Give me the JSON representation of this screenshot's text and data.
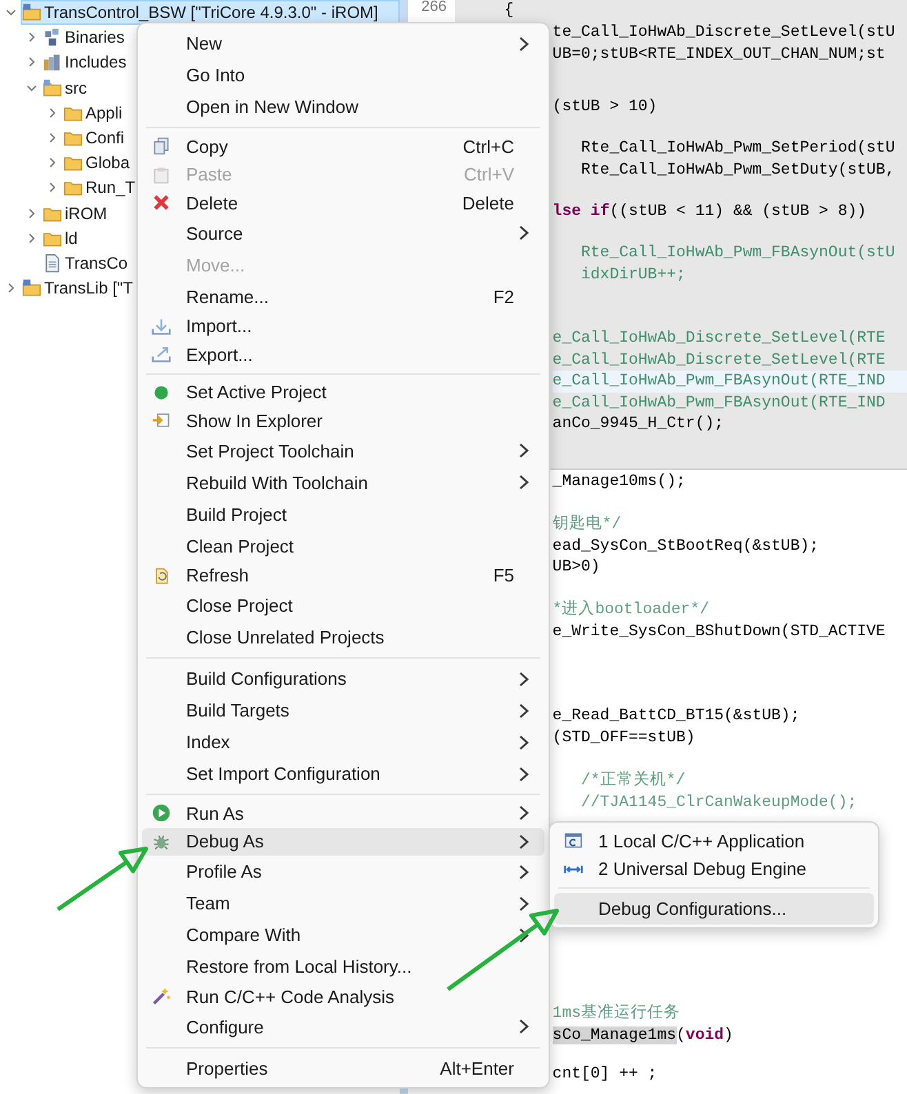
{
  "explorer": {
    "items": [
      {
        "label": "TransControl_BSW [\"TriCore 4.9.3.0\" - iROM]",
        "kind": "project",
        "expanded": true,
        "selected": true,
        "children": [
          {
            "label": "Binaries",
            "kind": "binaries",
            "expanded": false,
            "selected": false
          },
          {
            "label": "Includes",
            "kind": "includes",
            "expanded": false,
            "selected": false
          },
          {
            "label": "src",
            "kind": "source-folder",
            "expanded": true,
            "selected": false,
            "children": [
              {
                "label": "Appli",
                "kind": "folder",
                "expanded": false,
                "selected": false
              },
              {
                "label": "Confi",
                "kind": "folder",
                "expanded": false,
                "selected": false
              },
              {
                "label": "Globa",
                "kind": "folder",
                "expanded": false,
                "selected": false
              },
              {
                "label": "Run_T",
                "kind": "folder",
                "expanded": false,
                "selected": false
              }
            ]
          },
          {
            "label": "iROM",
            "kind": "folder",
            "expanded": false,
            "selected": false
          },
          {
            "label": "ld",
            "kind": "folder",
            "expanded": false,
            "selected": false
          },
          {
            "label": "TransCo",
            "kind": "file",
            "selected": false
          }
        ]
      },
      {
        "label": "TransLib [\"T",
        "kind": "project",
        "expanded": false,
        "selected": false
      }
    ]
  },
  "editor": {
    "line_numbers": [
      "266"
    ],
    "popup_blocks": [
      [
        {
          "current": false,
          "segments": [
            {
              "kind": "plain",
              "text": "{"
            }
          ]
        }
      ],
      [
        {
          "current": false,
          "segments": [
            {
              "kind": "plain",
              "text": "te_Call_IoHwAb_Discrete_SetLevel(stU"
            }
          ]
        }
      ],
      [
        {
          "current": false,
          "segments": [
            {
              "kind": "plain",
              "text": "UB=0;stUB<RTE_INDEX_OUT_CHAN_NUM;st"
            }
          ]
        }
      ],
      [
        {
          "current": false,
          "segments": [
            {
              "kind": "plain",
              "text": "(stUB > 10)"
            }
          ]
        }
      ],
      [
        {
          "current": false,
          "segments": [
            {
              "kind": "plain",
              "text": "   Rte_Call_IoHwAb_Pwm_SetPeriod(stU"
            }
          ]
        },
        {
          "current": false,
          "segments": [
            {
              "kind": "plain",
              "text": "   Rte_Call_IoHwAb_Pwm_SetDuty(stUB,"
            }
          ]
        }
      ],
      [
        {
          "current": false,
          "segments": [
            {
              "kind": "keyword",
              "text": "lse"
            },
            {
              "kind": "keyword",
              "text": " if"
            },
            {
              "kind": "plain",
              "text": "((stUB < 11) && (stUB > 8))"
            }
          ]
        }
      ],
      [
        {
          "current": false,
          "segments": [
            {
              "kind": "dim",
              "text": "   Rte_Call_IoHwAb_Pwm_FBAsynOut(stU"
            }
          ]
        },
        {
          "current": false,
          "segments": [
            {
              "kind": "dim",
              "text": "   idxDirUB++;"
            }
          ]
        }
      ],
      [
        {
          "current": false,
          "segments": [
            {
              "kind": "dim",
              "text": "e_Call_IoHwAb_Discrete_SetLevel(RTE"
            }
          ]
        },
        {
          "current": false,
          "segments": [
            {
              "kind": "dim",
              "text": "e_Call_IoHwAb_Discrete_SetLevel(RTE"
            }
          ]
        },
        {
          "current": true,
          "segments": [
            {
              "kind": "dim",
              "text": "e_Call_IoHwAb_Pwm_FBAsynOut(RTE_IND"
            }
          ]
        },
        {
          "current": false,
          "segments": [
            {
              "kind": "dim",
              "text": "e_Call_IoHwAb_Pwm_FBAsynOut(RTE_IND"
            }
          ]
        },
        {
          "current": false,
          "segments": [
            {
              "kind": "plain",
              "text": "anCo_9945_H_Ctr();"
            }
          ]
        }
      ]
    ],
    "blocks": [
      [
        {
          "current": false,
          "segments": [
            {
              "kind": "plain",
              "text": "_Manage10ms();"
            }
          ]
        }
      ],
      [
        {
          "current": false,
          "segments": [
            {
              "kind": "comment",
              "text": "钥匙电*/"
            }
          ]
        },
        {
          "current": false,
          "segments": [
            {
              "kind": "plain",
              "text": "ead_SysCon_StBootReq(&stUB);"
            }
          ]
        },
        {
          "current": false,
          "segments": [
            {
              "kind": "plain",
              "text": "UB>0)"
            }
          ]
        }
      ],
      [
        {
          "current": false,
          "segments": [
            {
              "kind": "comment",
              "text": "*进入bootloader*/"
            }
          ]
        },
        {
          "current": false,
          "segments": [
            {
              "kind": "plain",
              "text": "e_Write_SysCon_BShutDown(STD_ACTIVE"
            }
          ]
        }
      ],
      [
        {
          "current": false,
          "segments": [
            {
              "kind": "plain",
              "text": "e_Read_BattCD_BT15(&stUB);"
            }
          ]
        },
        {
          "current": false,
          "segments": [
            {
              "kind": "plain",
              "text": "(STD_OFF==stUB)"
            }
          ]
        }
      ],
      [
        {
          "current": false,
          "segments": [
            {
              "kind": "comment",
              "text": "   /*正常关机*/"
            }
          ]
        },
        {
          "current": false,
          "segments": [
            {
              "kind": "comment",
              "text": "   //TJA1145_ClrCanWakeupMode();"
            }
          ]
        }
      ],
      [
        {
          "current": false,
          "segments": [
            {
              "kind": "comment",
              "text": "1ms基准运行任务"
            }
          ]
        },
        {
          "current": false,
          "segments": [
            {
              "kind": "occurrence",
              "text": "sCo_Manage1ms"
            },
            {
              "kind": "plain",
              "text": "("
            },
            {
              "kind": "keyword",
              "text": "void"
            },
            {
              "kind": "plain",
              "text": ")"
            }
          ]
        }
      ],
      [
        {
          "current": false,
          "segments": [
            {
              "kind": "plain",
              "text": "cnt[0] ++ ;"
            }
          ]
        }
      ]
    ]
  },
  "context_menu": {
    "groups": [
      {
        "items": [
          {
            "label": "New",
            "submenu": true,
            "disabled": false,
            "selected": false
          },
          {
            "label": "Go Into",
            "submenu": false,
            "disabled": false,
            "selected": false
          },
          {
            "label": "Open in New Window",
            "submenu": false,
            "disabled": false,
            "selected": false
          }
        ]
      },
      {
        "items": [
          {
            "label": "Copy",
            "shortcut": "Ctrl+C",
            "kind": "copy",
            "submenu": false,
            "disabled": false,
            "selected": false
          },
          {
            "label": "Paste",
            "shortcut": "Ctrl+V",
            "kind": "paste",
            "submenu": false,
            "disabled": true,
            "selected": false
          },
          {
            "label": "Delete",
            "shortcut": "Delete",
            "kind": "delete",
            "submenu": false,
            "disabled": false,
            "selected": false
          },
          {
            "label": "Source",
            "submenu": true,
            "disabled": false,
            "selected": false
          },
          {
            "label": "Move...",
            "submenu": false,
            "disabled": true,
            "selected": false
          },
          {
            "label": "Rename...",
            "shortcut": "F2",
            "submenu": false,
            "disabled": false,
            "selected": false
          },
          {
            "label": "Import...",
            "kind": "import",
            "submenu": false,
            "disabled": false,
            "selected": false
          },
          {
            "label": "Export...",
            "kind": "export",
            "submenu": false,
            "disabled": false,
            "selected": false
          }
        ]
      },
      {
        "items": [
          {
            "label": "Set Active Project",
            "kind": "active",
            "submenu": false,
            "disabled": false,
            "selected": false
          },
          {
            "label": "Show In Explorer",
            "kind": "explorer",
            "submenu": false,
            "disabled": false,
            "selected": false
          },
          {
            "label": "Set Project Toolchain",
            "submenu": true,
            "disabled": false,
            "selected": false
          },
          {
            "label": "Rebuild With Toolchain",
            "submenu": true,
            "disabled": false,
            "selected": false
          },
          {
            "label": "Build Project",
            "submenu": false,
            "disabled": false,
            "selected": false
          },
          {
            "label": "Clean Project",
            "submenu": false,
            "disabled": false,
            "selected": false
          },
          {
            "label": "Refresh",
            "shortcut": "F5",
            "kind": "refresh",
            "submenu": false,
            "disabled": false,
            "selected": false
          },
          {
            "label": "Close Project",
            "submenu": false,
            "disabled": false,
            "selected": false
          },
          {
            "label": "Close Unrelated Projects",
            "submenu": false,
            "disabled": false,
            "selected": false
          }
        ]
      },
      {
        "items": [
          {
            "label": "Build Configurations",
            "submenu": true,
            "disabled": false,
            "selected": false
          },
          {
            "label": "Build Targets",
            "submenu": true,
            "disabled": false,
            "selected": false
          },
          {
            "label": "Index",
            "submenu": true,
            "disabled": false,
            "selected": false
          },
          {
            "label": "Set Import Configuration",
            "submenu": true,
            "disabled": false,
            "selected": false
          }
        ]
      },
      {
        "items": [
          {
            "label": "Run As",
            "kind": "run",
            "submenu": true,
            "disabled": false,
            "selected": false
          },
          {
            "label": "Debug As",
            "kind": "debug",
            "submenu": true,
            "disabled": false,
            "selected": true
          },
          {
            "label": "Profile As",
            "submenu": true,
            "disabled": false,
            "selected": false
          },
          {
            "label": "Team",
            "submenu": true,
            "disabled": false,
            "selected": false
          },
          {
            "label": "Compare With",
            "submenu": true,
            "disabled": false,
            "selected": false
          },
          {
            "label": "Restore from Local History...",
            "submenu": false,
            "disabled": false,
            "selected": false
          },
          {
            "label": "Run C/C++ Code Analysis",
            "kind": "analysis",
            "submenu": false,
            "disabled": false,
            "selected": false
          },
          {
            "label": "Configure",
            "submenu": true,
            "disabled": false,
            "selected": false
          }
        ]
      },
      {
        "items": [
          {
            "label": "Properties",
            "shortcut": "Alt+Enter",
            "submenu": false,
            "disabled": false,
            "selected": false
          }
        ]
      }
    ]
  },
  "submenu": {
    "groups": [
      {
        "items": [
          {
            "label": "1 Local C/C++ Application",
            "kind": "local-app",
            "submenu": false,
            "disabled": false,
            "selected": false
          },
          {
            "label": "2 Universal Debug Engine",
            "kind": "debug-engine",
            "submenu": false,
            "disabled": false,
            "selected": false
          }
        ]
      },
      {
        "items": [
          {
            "label": "Debug Configurations...",
            "submenu": false,
            "disabled": false,
            "selected": true
          }
        ]
      }
    ]
  },
  "annotations": [
    {
      "kind": "arrow"
    },
    {
      "kind": "arrow"
    }
  ]
}
